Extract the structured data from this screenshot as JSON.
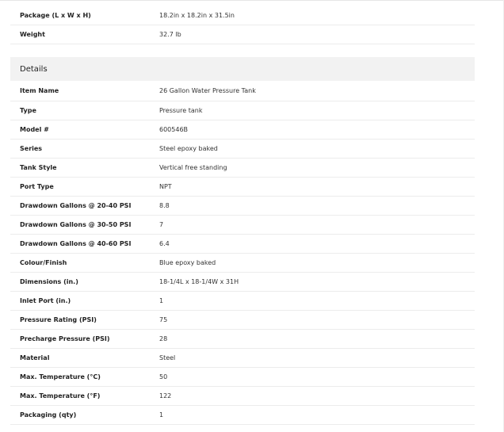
{
  "top_rows": [
    {
      "label": "Package (L x W x H)",
      "value": "18.2in x 18.2in x 31.5in"
    },
    {
      "label": "Weight",
      "value": "32.7 lb"
    }
  ],
  "details": {
    "title": "Details",
    "rows": [
      {
        "label": "Item Name",
        "value": "26 Gallon Water Pressure Tank"
      },
      {
        "label": "Type",
        "value": "Pressure tank"
      },
      {
        "label": "Model #",
        "value": "600546B"
      },
      {
        "label": "Series",
        "value": "Steel epoxy baked"
      },
      {
        "label": "Tank Style",
        "value": "Vertical free standing"
      },
      {
        "label": "Port Type",
        "value": "NPT"
      },
      {
        "label": "Drawdown Gallons @ 20-40 PSI",
        "value": "8.8"
      },
      {
        "label": "Drawdown Gallons @ 30-50 PSI",
        "value": "7"
      },
      {
        "label": "Drawdown Gallons @ 40-60 PSI",
        "value": "6.4"
      },
      {
        "label": "Colour/Finish",
        "value": "Blue epoxy baked"
      },
      {
        "label": "Dimensions (in.)",
        "value": "18-1/4L x 18-1/4W x 31H"
      },
      {
        "label": "Inlet Port (in.)",
        "value": "1"
      },
      {
        "label": "Pressure Rating (PSI)",
        "value": "75"
      },
      {
        "label": "Precharge Pressure (PSI)",
        "value": "28"
      },
      {
        "label": "Material",
        "value": "Steel"
      },
      {
        "label": "Max. Temperature (°C)",
        "value": "50"
      },
      {
        "label": "Max. Temperature (°F)",
        "value": "122"
      },
      {
        "label": "Packaging (qty)",
        "value": "1"
      }
    ]
  }
}
